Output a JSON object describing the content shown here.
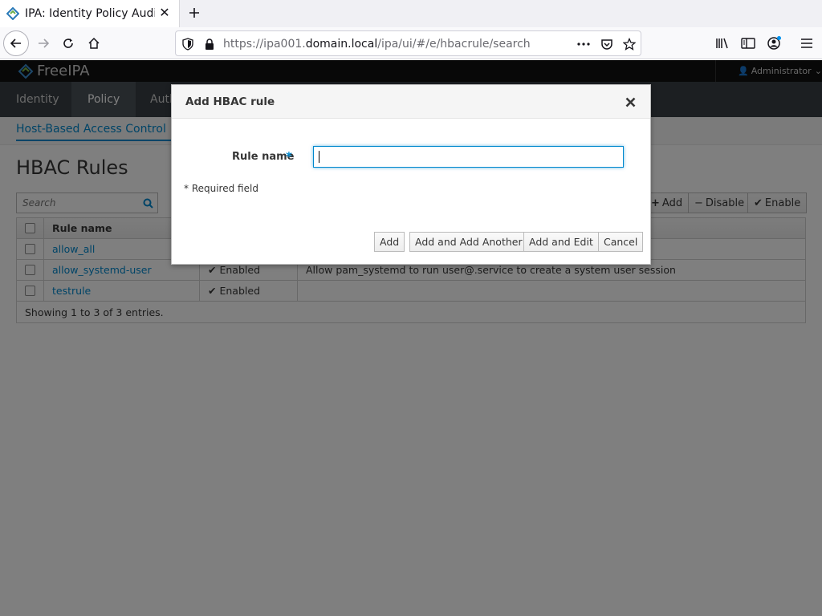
{
  "browser": {
    "tab_title": "IPA: Identity Policy Audit",
    "url_prefix": "https://ipa001.",
    "url_domain": "domain.local",
    "url_path": "/ipa/ui/#/e/hbacrule/search"
  },
  "masthead": {
    "brand": "FreeIPA",
    "user": "Administrator"
  },
  "mainnav": {
    "items": [
      "Identity",
      "Policy",
      "Auth"
    ]
  },
  "subnav": {
    "active": "Host-Based Access Control"
  },
  "page": {
    "title": "HBAC Rules",
    "search_placeholder": "Search",
    "actions": {
      "add": "Add",
      "disable": "Disable",
      "enable": "Enable"
    }
  },
  "grid": {
    "columns": [
      "Rule name"
    ],
    "rows": [
      {
        "name": "allow_all",
        "status": "",
        "description": ""
      },
      {
        "name": "allow_systemd-user",
        "status": "Enabled",
        "description": "Allow pam_systemd to run user@.service to create a system user session"
      },
      {
        "name": "testrule",
        "status": "Enabled",
        "description": ""
      }
    ],
    "footer": "Showing 1 to 3 of 3 entries."
  },
  "dialog": {
    "title": "Add HBAC rule",
    "field_label": "Rule name",
    "required_marker": "*",
    "field_value": "",
    "required_note": "* Required field",
    "buttons": {
      "add": "Add",
      "add_another": "Add and Add Another",
      "add_edit": "Add and Edit",
      "cancel": "Cancel"
    }
  },
  "colors": {
    "accent": "#0088ce",
    "masthead": "#101010",
    "nav": "#393f45"
  }
}
